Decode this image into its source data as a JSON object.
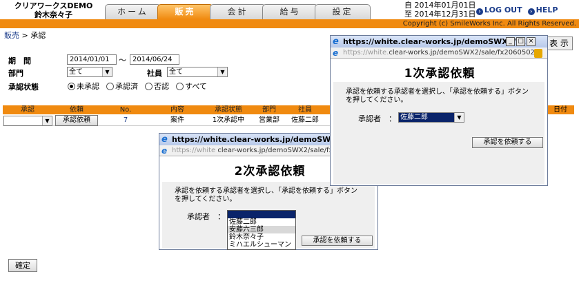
{
  "header": {
    "company_line1": "クリアワークスDEMO",
    "company_line2": "鈴木奈々子",
    "tabs": [
      {
        "label": "ホーム",
        "active": false
      },
      {
        "label": "販売",
        "active": true
      },
      {
        "label": "会計",
        "active": false
      },
      {
        "label": "給与",
        "active": false
      },
      {
        "label": "設定",
        "active": false
      }
    ],
    "from_label": "自",
    "from_date": "2014年01月01日",
    "to_label": "至",
    "to_date": "2014年12月31日",
    "logout": "LOG OUT",
    "help": "HELP",
    "copyright": "Copyright (c) SmileWorks Inc. All Rights Reserved.",
    "accent_color": "#f08a10"
  },
  "breadcrumb": {
    "link": "販売",
    "sep": ">",
    "current": "承認"
  },
  "filters": {
    "period_label": "期　間",
    "date_from": "2014/01/01",
    "tilde": "～",
    "date_to": "2014/06/24",
    "dept_label": "部門",
    "dept_value": "全て",
    "staff_label": "社員",
    "staff_value": "全て",
    "status_label": "承認状態",
    "status_options": [
      {
        "label": "未承認",
        "checked": true
      },
      {
        "label": "承認済",
        "checked": false
      },
      {
        "label": "否認",
        "checked": false
      },
      {
        "label": "すべて",
        "checked": false
      }
    ],
    "display_button": "表 示"
  },
  "table": {
    "headers": [
      "承認",
      "依頼",
      "No.",
      "内容",
      "承認状態",
      "部門",
      "社員"
    ],
    "right_header": "日付",
    "rows": [
      {
        "approval_select": "",
        "request_button": "承認依頼",
        "no": "7",
        "content": "案件",
        "status": "1次承認中",
        "dept": "営業部",
        "staff": "佐藤二郎"
      }
    ]
  },
  "confirm_button": "確定",
  "popup1": {
    "title": "https://white.clear-works.jp/demoSWX2/s...",
    "address_prefix": "https://white.",
    "address_rest": "clear-works.jp/demoSWX2/sale/fx2060502",
    "heading": "1次承認依頼",
    "message_line1": "承認を依頼する承認者を選択し、「承認を依頼する」ボタン",
    "message_line2": "を押してください。",
    "approver_label": "承認者　：",
    "approver_value": "佐藤二郎",
    "submit_button": "承認を依頼する",
    "minimize": "_",
    "maximize": "□",
    "close": "×"
  },
  "popup2": {
    "title": "https://white.clear-works.jp/demoSWX2/",
    "address_prefix": "https://white",
    "address_rest": "clear-works.jp/demoSWX2/sale/fx",
    "heading": "2次承認依頼",
    "message_line1": "承認を依頼する承認者を選択し、「承認を依頼する」ボタン",
    "message_line2": "を押してください。",
    "approver_label": "承認者　：",
    "options": [
      "",
      "佐藤二郎",
      "安藤六三郎",
      "鈴木奈々子",
      "ミハエルシューマン"
    ],
    "submit_button": "承認を依頼する"
  }
}
